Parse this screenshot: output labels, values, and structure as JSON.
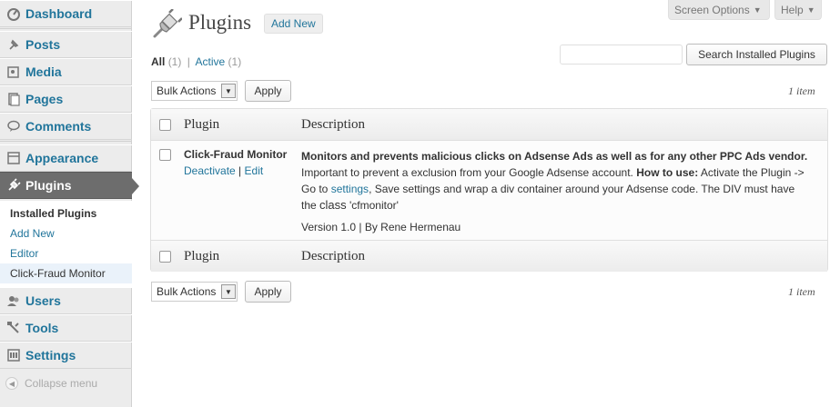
{
  "sidebar": {
    "items": [
      {
        "label": "Dashboard",
        "icon": "dashboard-icon"
      },
      {
        "label": "Posts",
        "icon": "pin-icon"
      },
      {
        "label": "Media",
        "icon": "media-icon"
      },
      {
        "label": "Pages",
        "icon": "pages-icon"
      },
      {
        "label": "Comments",
        "icon": "comments-icon"
      },
      {
        "label": "Appearance",
        "icon": "appearance-icon"
      },
      {
        "label": "Plugins",
        "icon": "plugin-icon"
      },
      {
        "label": "Users",
        "icon": "users-icon"
      },
      {
        "label": "Tools",
        "icon": "tools-icon"
      },
      {
        "label": "Settings",
        "icon": "settings-icon"
      }
    ],
    "submenu": [
      "Installed Plugins",
      "Add New",
      "Editor",
      "Click-Fraud Monitor"
    ],
    "collapse": "Collapse menu"
  },
  "header": {
    "screen_options": "Screen Options",
    "help": "Help",
    "title": "Plugins",
    "add_new": "Add New"
  },
  "filters": {
    "all": "All",
    "all_count": "(1)",
    "sep": "|",
    "active": "Active",
    "active_count": "(1)"
  },
  "search": {
    "value": "",
    "button": "Search Installed Plugins"
  },
  "bulk": {
    "select": "Bulk Actions",
    "apply": "Apply",
    "count": "1 item"
  },
  "table": {
    "col_plugin": "Plugin",
    "col_description": "Description",
    "row": {
      "name": "Click-Fraud Monitor",
      "deactivate": "Deactivate",
      "sep": "|",
      "edit": "Edit",
      "desc_bold": "Monitors and prevents malicious clicks on Adsense Ads as well as for any other PPC Ads vendor.",
      "desc_1": "Important to prevent a exclusion from your Google Adsense account.",
      "desc_howto": "How to use:",
      "desc_2": "Activate the Plugin -> Go to",
      "desc_link": "settings",
      "desc_3": ", Save settings and wrap a div container around your Adsense code. The DIV must have the",
      "desc_class": "class",
      "desc_4": "'cfmonitor'",
      "version": "Version 1.0 | By Rene Hermenau"
    }
  },
  "colors": {
    "link": "#21759b",
    "current_menu": "#6d6d6d",
    "sidebar_bg": "#ececec"
  }
}
